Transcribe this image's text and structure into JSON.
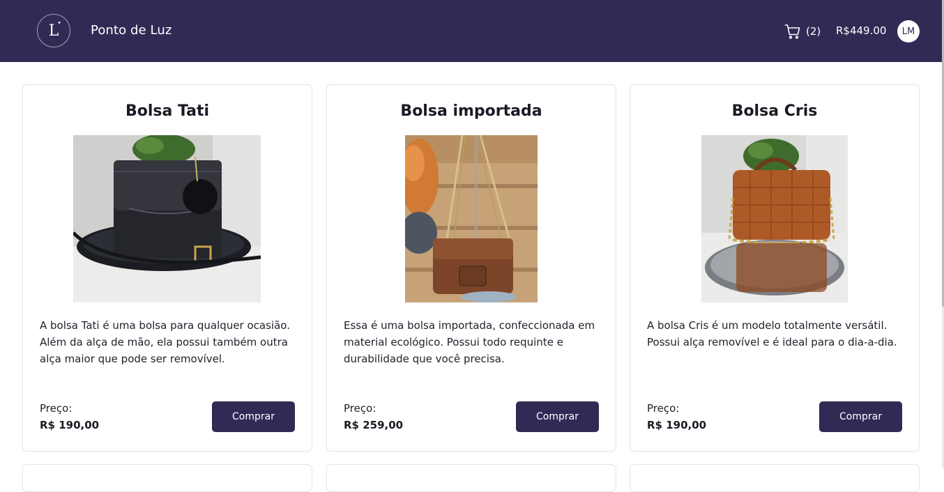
{
  "header": {
    "logo_letter": "L",
    "brand": "Ponto de Luz",
    "cart_count": "(2)",
    "cart_total": "R$449.00",
    "user_initials": "LM",
    "background_color": "#322a55"
  },
  "products": [
    {
      "title": "Bolsa Tati",
      "description": "A bolsa Tati é uma bolsa para qualquer ocasião. Além da alça de mão, ela possui também outra alça maior que pode ser removível.",
      "price_label": "Preço:",
      "price": "R$ 190,00",
      "button": "Comprar",
      "image_icon": "black-handbag-photo"
    },
    {
      "title": "Bolsa importada",
      "description": "Essa é uma bolsa importada, confeccionada em material ecológico. Possui todo requinte e durabilidade que você precisa.",
      "price_label": "Preço:",
      "price": "R$ 259,00",
      "button": "Comprar",
      "image_icon": "brown-chain-bag-photo"
    },
    {
      "title": "Bolsa Cris",
      "description": "A bolsa Cris é um modelo totalmente versátil. Possui alça removível e é ideal para o dia-a-dia.",
      "price_label": "Preço:",
      "price": "R$ 190,00",
      "button": "Comprar",
      "image_icon": "caramel-quilted-bag-photo"
    }
  ]
}
